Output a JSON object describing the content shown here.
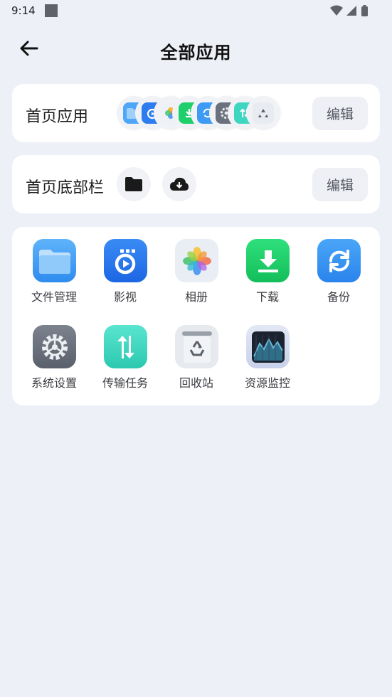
{
  "status": {
    "time": "9:14"
  },
  "header": {
    "title": "全部应用"
  },
  "home_apps": {
    "label": "首页应用",
    "edit_label": "编辑",
    "icons": [
      "file-manager-icon",
      "video-icon",
      "photos-icon",
      "download-icon",
      "backup-icon",
      "settings-icon",
      "transfer-icon",
      "recycle-bin-icon"
    ]
  },
  "bottom_bar": {
    "label": "首页底部栏",
    "edit_label": "编辑",
    "icons": [
      "folder-icon",
      "cloud-download-icon"
    ]
  },
  "apps": [
    {
      "label": "文件管理",
      "icon": "file-manager-icon"
    },
    {
      "label": "影视",
      "icon": "video-icon"
    },
    {
      "label": "相册",
      "icon": "photos-icon"
    },
    {
      "label": "下载",
      "icon": "download-icon"
    },
    {
      "label": "备份",
      "icon": "backup-icon"
    },
    {
      "label": "系统设置",
      "icon": "settings-icon"
    },
    {
      "label": "传输任务",
      "icon": "transfer-icon"
    },
    {
      "label": "回收站",
      "icon": "recycle-bin-icon"
    },
    {
      "label": "资源监控",
      "icon": "resource-monitor-icon"
    }
  ],
  "colors": {
    "background": "#eef0f7",
    "card": "#ffffff",
    "edit_button": "#eef0f6",
    "files_blue": "#3d9af5",
    "download_green": "#1fcf6b",
    "transfer_teal": "#3ed6c0",
    "settings_gray": "#6b717c"
  }
}
